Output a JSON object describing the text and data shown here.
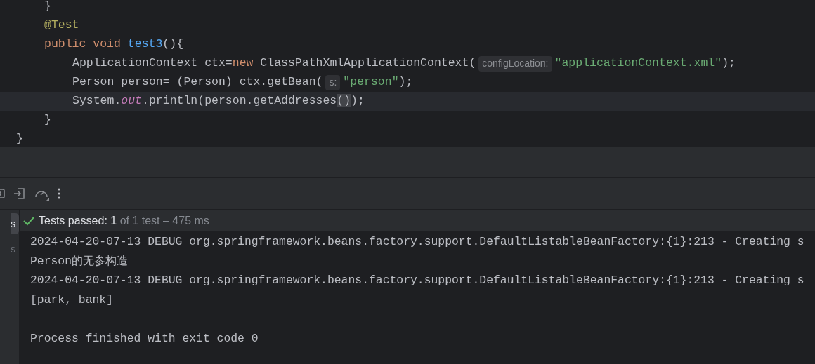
{
  "editor": {
    "lines": [
      {
        "children": [
          {
            "current": false,
            "tokens": [
              {
                "kind": "plain",
                "text": "}"
              }
            ]
          },
          {
            "current": false,
            "tokens": [
              {
                "kind": "annotation",
                "text": "@Test"
              }
            ]
          },
          {
            "current": false,
            "tokens": [
              {
                "kind": "keyword",
                "text": "public void "
              },
              {
                "kind": "method",
                "text": "test3"
              },
              {
                "kind": "plain",
                "text": "(){"
              }
            ],
            "children": [
              {
                "current": false,
                "tokens": [
                  {
                    "kind": "plain",
                    "text": "ApplicationContext ctx="
                  },
                  {
                    "kind": "keyword",
                    "text": "new "
                  },
                  {
                    "kind": "plain",
                    "text": "ClassPathXmlApplicationContext("
                  },
                  {
                    "kind": "hint",
                    "text": "configLocation:"
                  },
                  {
                    "kind": "string",
                    "text": "\"applicationContext.xml\""
                  },
                  {
                    "kind": "plain",
                    "text": ");"
                  }
                ]
              },
              {
                "current": false,
                "tokens": [
                  {
                    "kind": "plain",
                    "text": "Person person= (Person) ctx.getBean("
                  },
                  {
                    "kind": "hint",
                    "text": "s:"
                  },
                  {
                    "kind": "string",
                    "text": "\"person\""
                  },
                  {
                    "kind": "plain",
                    "text": ");"
                  }
                ]
              },
              {
                "current": true,
                "tokens": [
                  {
                    "kind": "plain",
                    "text": "System."
                  },
                  {
                    "kind": "field",
                    "text": "out"
                  },
                  {
                    "kind": "plain",
                    "text": ".println(person.getAddresses"
                  },
                  {
                    "kind": "matched",
                    "text": "()"
                  },
                  {
                    "kind": "plain",
                    "text": ");"
                  }
                ]
              }
            ]
          },
          {
            "current": false,
            "tokens": [
              {
                "kind": "plain",
                "text": "}"
              }
            ]
          }
        ]
      },
      {
        "current": false,
        "tokens": [
          {
            "kind": "plain",
            "text": "}"
          }
        ]
      }
    ]
  },
  "side_tabs": [
    {
      "label": "s",
      "selected": true
    },
    {
      "label": "s",
      "selected": false
    }
  ],
  "test_status": {
    "passed_label": "Tests passed:",
    "passed_count": "1",
    "detail": "of 1 test – 475 ms"
  },
  "console": {
    "log_lines": [
      "2024-04-20-07-13 DEBUG org.springframework.beans.factory.support.DefaultListableBeanFactory:{1}:213 - Creating s",
      "Person的无参构造",
      "2024-04-20-07-13 DEBUG org.springframework.beans.factory.support.DefaultListableBeanFactory:{1}:213 - Creating s",
      "[park, bank]"
    ],
    "exit_message": "Process finished with exit code 0"
  }
}
